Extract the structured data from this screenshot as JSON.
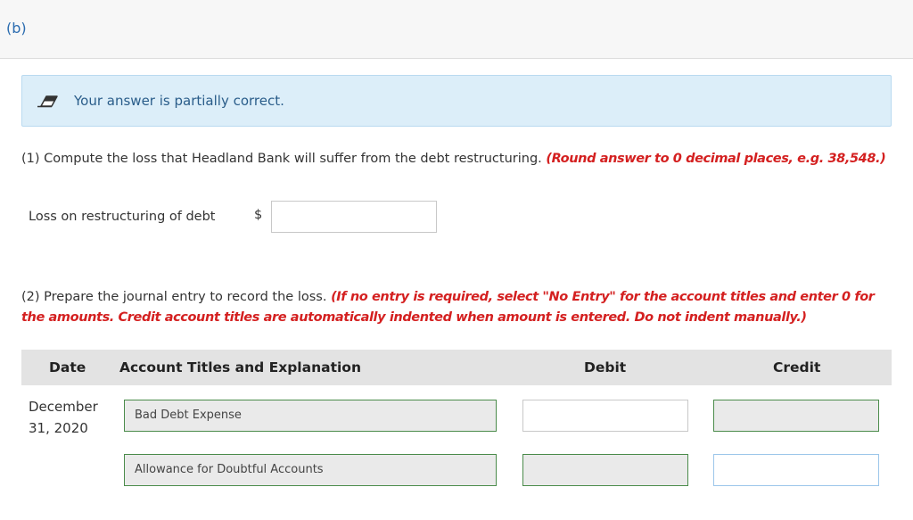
{
  "section": {
    "label": "(b)"
  },
  "alert": {
    "icon": "pencil-eraser-icon",
    "text": "Your answer is partially correct."
  },
  "part1": {
    "question": "(1) Compute the loss that Headland Bank will suffer from the debt restructuring.",
    "instruction": "(Round answer to 0 decimal places, e.g. 38,548.)",
    "loss_label": "Loss on restructuring of debt",
    "currency": "$",
    "loss_value": ""
  },
  "part2": {
    "question": "(2) Prepare the journal entry to record the loss.",
    "instruction": "(If no entry is required, select \"No Entry\" for the account titles and enter 0 for the amounts. Credit account titles are automatically indented when amount is entered. Do not indent manually.)"
  },
  "journal": {
    "columns": {
      "date": "Date",
      "account": "Account Titles and Explanation",
      "debit": "Debit",
      "credit": "Credit"
    },
    "date_line1": "December",
    "date_line2": "31, 2020",
    "rows": [
      {
        "account": "Bad Debt Expense",
        "debit": "",
        "credit": ""
      },
      {
        "account": "Allowance for Doubtful Accounts",
        "debit": "",
        "credit": ""
      }
    ]
  },
  "colors": {
    "alert_bg": "#dceef9",
    "red_text": "#d42020",
    "correct_border": "#4a8b4a",
    "focus_border": "#9cc6ea"
  }
}
